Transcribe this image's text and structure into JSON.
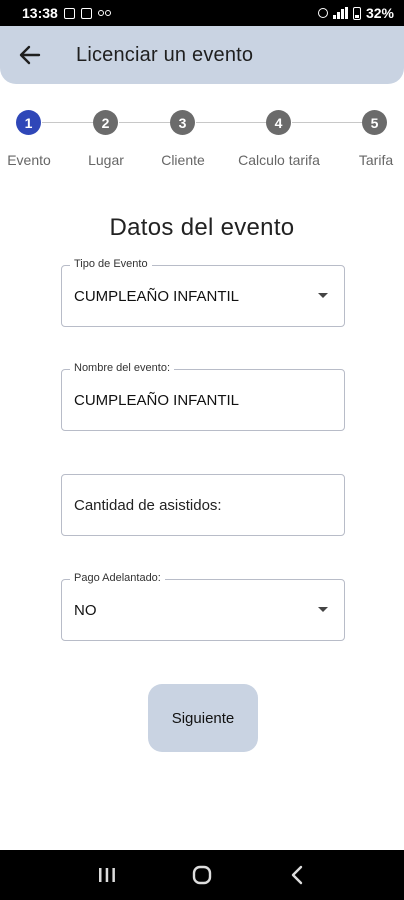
{
  "status_bar": {
    "time": "13:38",
    "battery": "32%"
  },
  "app_bar": {
    "title": "Licenciar un evento",
    "back_icon": "arrow-left-icon"
  },
  "stepper": {
    "active_index": 0,
    "steps": [
      {
        "number": "1",
        "label": "Evento"
      },
      {
        "number": "2",
        "label": "Lugar"
      },
      {
        "number": "3",
        "label": "Cliente"
      },
      {
        "number": "4",
        "label": "Calculo tarifa"
      },
      {
        "number": "5",
        "label": "Tarifa"
      }
    ]
  },
  "form": {
    "section_title": "Datos del evento",
    "tipo_evento": {
      "label": "Tipo de Evento",
      "value": "CUMPLEAÑO INFANTIL"
    },
    "nombre_evento": {
      "label": "Nombre del evento:",
      "value": "CUMPLEAÑO INFANTIL"
    },
    "cantidad_asistidos": {
      "placeholder": "Cantidad de asistidos:"
    },
    "pago_adelantado": {
      "label": "Pago Adelantado:",
      "value": "NO"
    },
    "next_button": "Siguiente"
  },
  "colors": {
    "app_bar_bg": "#c9d3e2",
    "active_step": "#2f47b8",
    "inactive_step": "#6b6b6b"
  }
}
